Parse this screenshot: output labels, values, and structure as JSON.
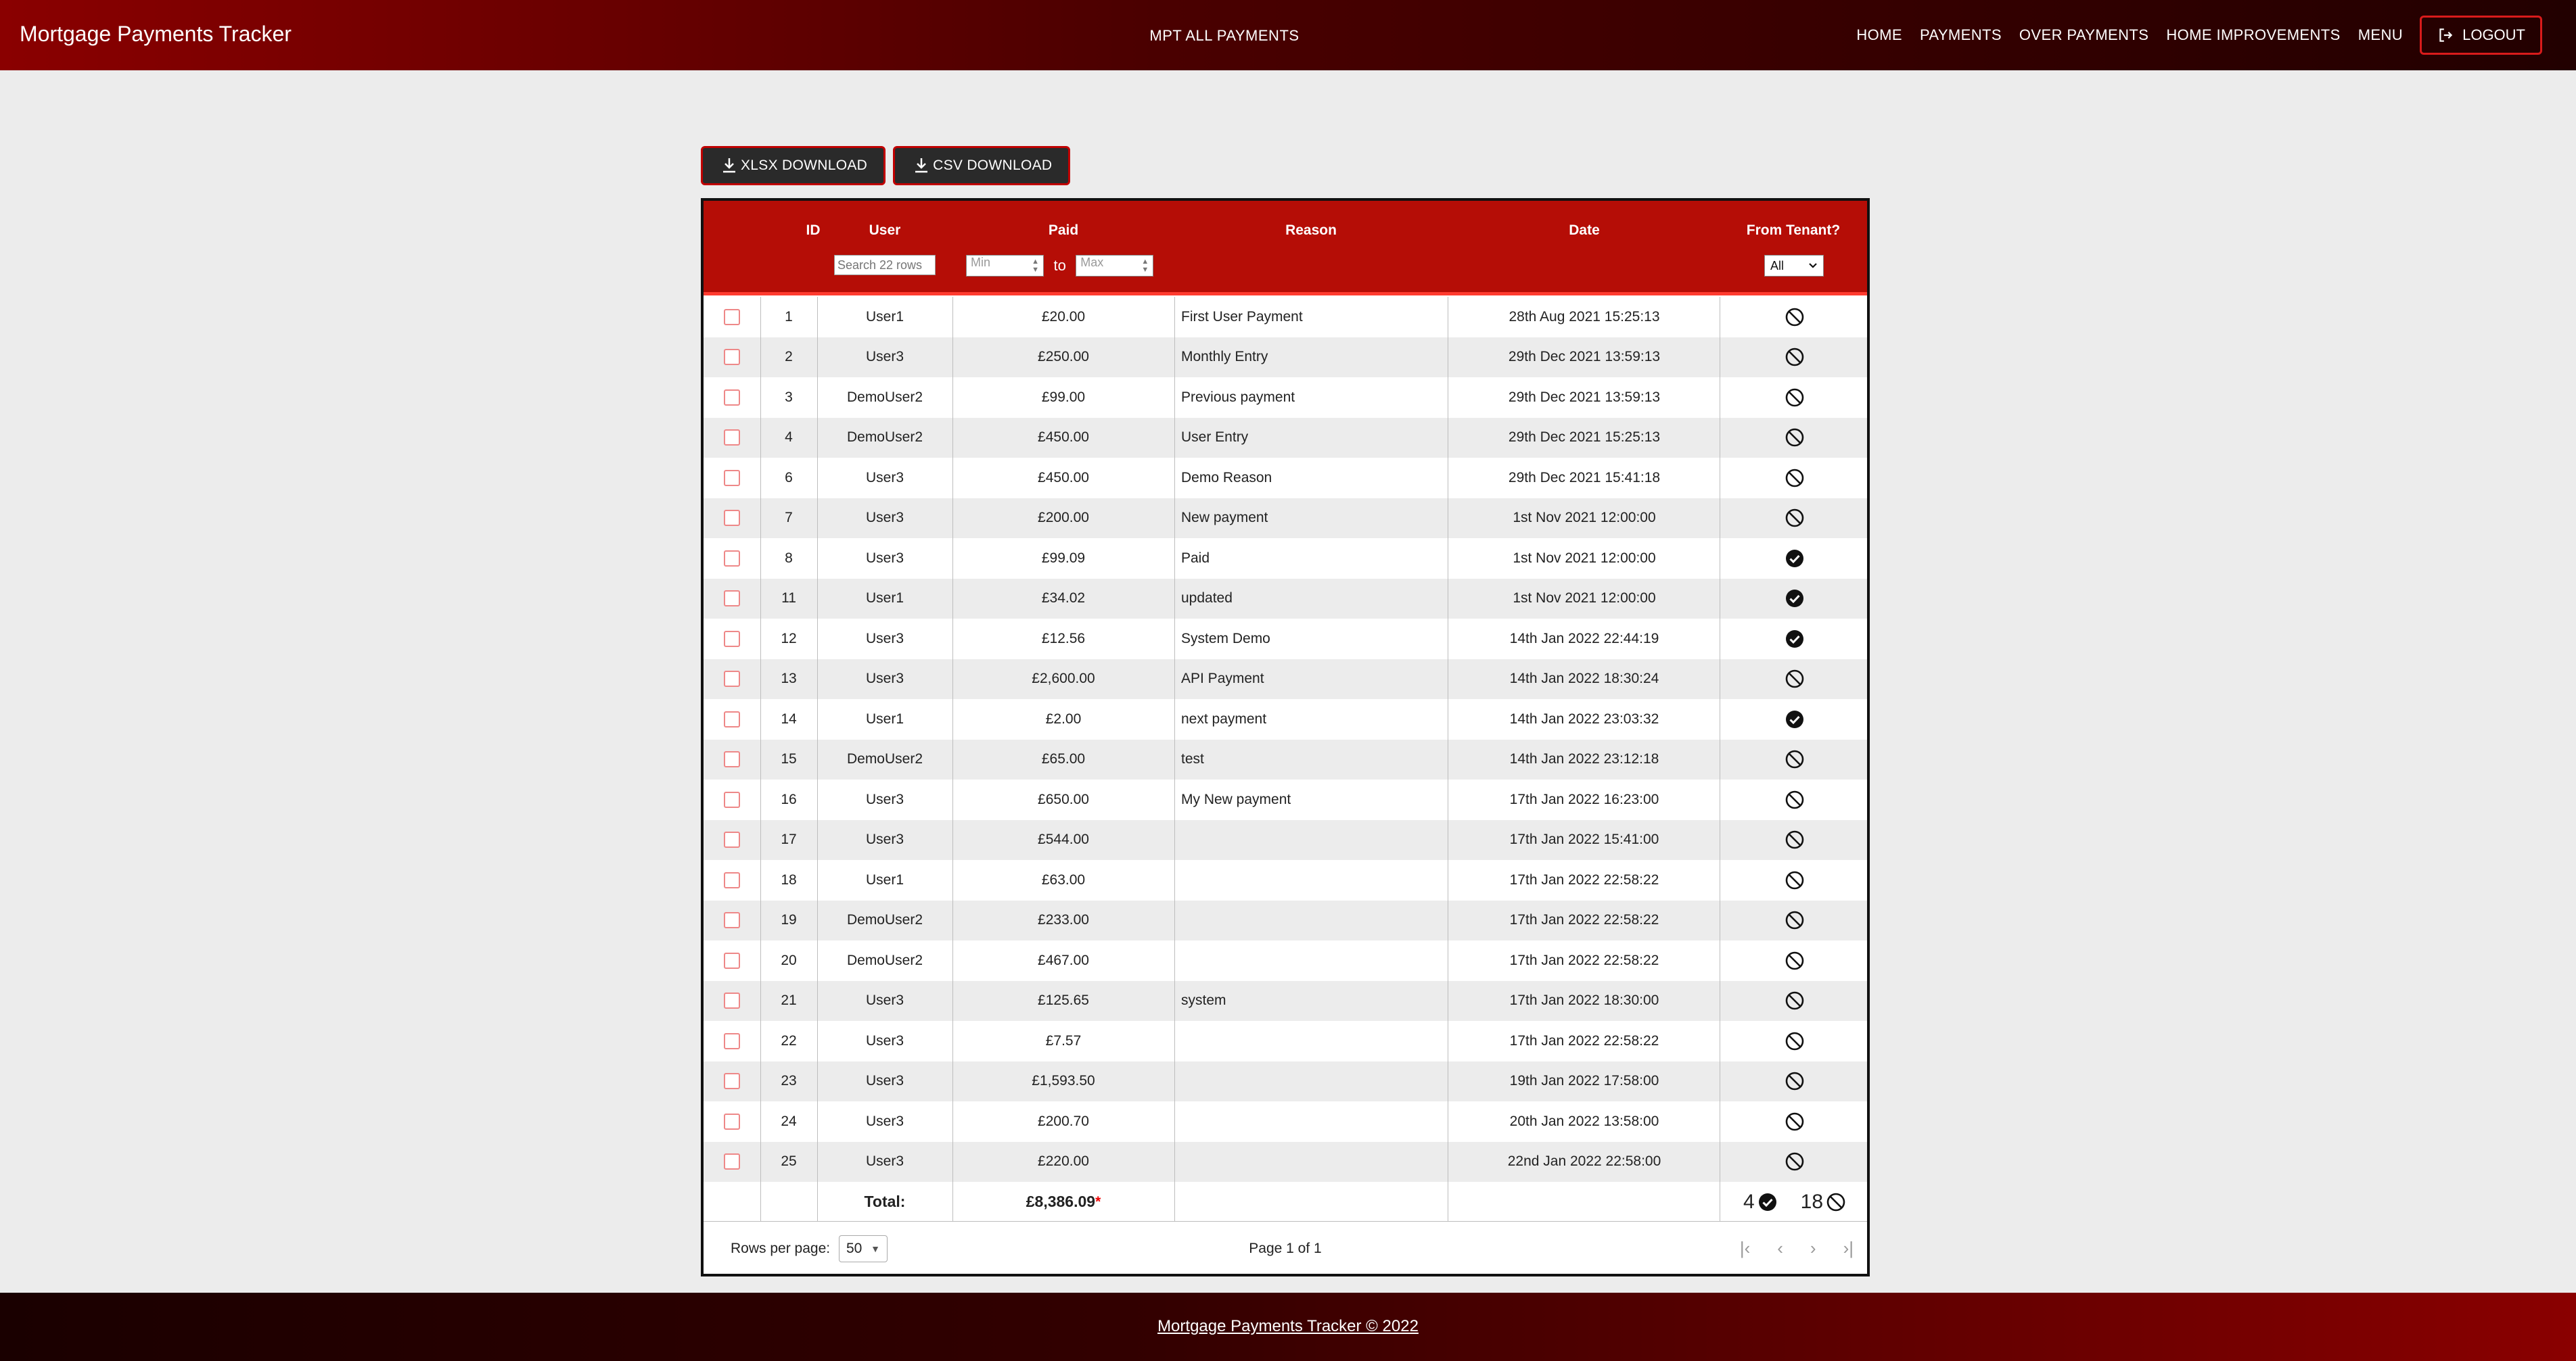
{
  "header": {
    "brand": "Mortgage Payments Tracker",
    "center_title": "MPT ALL PAYMENTS",
    "nav": [
      "HOME",
      "PAYMENTS",
      "OVER PAYMENTS",
      "HOME IMPROVEMENTS",
      "MENU"
    ],
    "logout": "LOGOUT"
  },
  "downloads": {
    "xlsx": "XLSX DOWNLOAD",
    "csv": "CSV DOWNLOAD"
  },
  "table": {
    "columns": {
      "id": "ID",
      "user": "User",
      "paid": "Paid",
      "reason": "Reason",
      "date": "Date",
      "tenant": "From Tenant?"
    },
    "filters": {
      "search_placeholder": "Search 22 rows",
      "min_placeholder": "Min",
      "to": "to",
      "max_placeholder": "Max",
      "tenant_select": "All"
    },
    "rows": [
      {
        "id": "1",
        "user": "User1",
        "paid": "£20.00",
        "reason": "First User Payment",
        "date": "28th Aug 2021 15:25:13",
        "tenant": false
      },
      {
        "id": "2",
        "user": "User3",
        "paid": "£250.00",
        "reason": "Monthly Entry",
        "date": "29th Dec 2021 13:59:13",
        "tenant": false
      },
      {
        "id": "3",
        "user": "DemoUser2",
        "paid": "£99.00",
        "reason": "Previous payment",
        "date": "29th Dec 2021 13:59:13",
        "tenant": false
      },
      {
        "id": "4",
        "user": "DemoUser2",
        "paid": "£450.00",
        "reason": "User Entry",
        "date": "29th Dec 2021 15:25:13",
        "tenant": false
      },
      {
        "id": "6",
        "user": "User3",
        "paid": "£450.00",
        "reason": "Demo Reason",
        "date": "29th Dec 2021 15:41:18",
        "tenant": false
      },
      {
        "id": "7",
        "user": "User3",
        "paid": "£200.00",
        "reason": "New payment",
        "date": "1st Nov 2021 12:00:00",
        "tenant": false
      },
      {
        "id": "8",
        "user": "User3",
        "paid": "£99.09",
        "reason": "Paid",
        "date": "1st Nov 2021 12:00:00",
        "tenant": true
      },
      {
        "id": "11",
        "user": "User1",
        "paid": "£34.02",
        "reason": "updated",
        "date": "1st Nov 2021 12:00:00",
        "tenant": true
      },
      {
        "id": "12",
        "user": "User3",
        "paid": "£12.56",
        "reason": "System Demo",
        "date": "14th Jan 2022 22:44:19",
        "tenant": true
      },
      {
        "id": "13",
        "user": "User3",
        "paid": "£2,600.00",
        "reason": "API Payment",
        "date": "14th Jan 2022 18:30:24",
        "tenant": false
      },
      {
        "id": "14",
        "user": "User1",
        "paid": "£2.00",
        "reason": "next payment",
        "date": "14th Jan 2022 23:03:32",
        "tenant": true
      },
      {
        "id": "15",
        "user": "DemoUser2",
        "paid": "£65.00",
        "reason": "test",
        "date": "14th Jan 2022 23:12:18",
        "tenant": false
      },
      {
        "id": "16",
        "user": "User3",
        "paid": "£650.00",
        "reason": "My New payment",
        "date": "17th Jan 2022 16:23:00",
        "tenant": false
      },
      {
        "id": "17",
        "user": "User3",
        "paid": "£544.00",
        "reason": "",
        "date": "17th Jan 2022 15:41:00",
        "tenant": false
      },
      {
        "id": "18",
        "user": "User1",
        "paid": "£63.00",
        "reason": "",
        "date": "17th Jan 2022 22:58:22",
        "tenant": false
      },
      {
        "id": "19",
        "user": "DemoUser2",
        "paid": "£233.00",
        "reason": "",
        "date": "17th Jan 2022 22:58:22",
        "tenant": false
      },
      {
        "id": "20",
        "user": "DemoUser2",
        "paid": "£467.00",
        "reason": "",
        "date": "17th Jan 2022 22:58:22",
        "tenant": false
      },
      {
        "id": "21",
        "user": "User3",
        "paid": "£125.65",
        "reason": "system",
        "date": "17th Jan 2022 18:30:00",
        "tenant": false
      },
      {
        "id": "22",
        "user": "User3",
        "paid": "£7.57",
        "reason": "",
        "date": "17th Jan 2022 22:58:22",
        "tenant": false
      },
      {
        "id": "23",
        "user": "User3",
        "paid": "£1,593.50",
        "reason": "",
        "date": "19th Jan 2022 17:58:00",
        "tenant": false
      },
      {
        "id": "24",
        "user": "User3",
        "paid": "£200.70",
        "reason": "",
        "date": "20th Jan 2022 13:58:00",
        "tenant": false
      },
      {
        "id": "25",
        "user": "User3",
        "paid": "£220.00",
        "reason": "",
        "date": "22nd Jan 2022 22:58:00",
        "tenant": false
      }
    ],
    "total_label": "Total:",
    "total_value": "£8,386.09",
    "total_marker": "*",
    "tenant_yes_count": "4",
    "tenant_no_count": "18",
    "rows_per_page_label": "Rows per page:",
    "rows_per_page": "50",
    "page_info": "Page 1 of 1"
  },
  "footer": {
    "text": "Mortgage Payments Tracker © 2022"
  },
  "icons": {
    "tenant_yes": "check-circle-icon",
    "tenant_no": "ban-icon"
  },
  "colors": {
    "header_red": "#b50d06",
    "accent_red": "#d81b1b",
    "dark": "#220000"
  }
}
